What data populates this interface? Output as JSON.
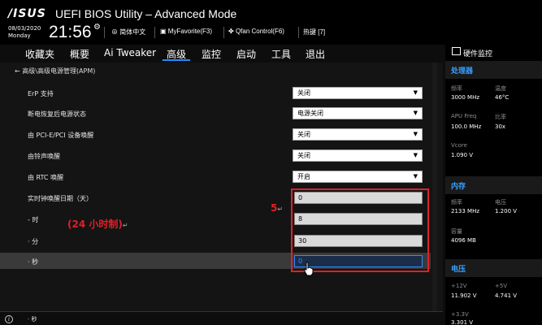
{
  "header": {
    "logo": "/ISUS",
    "title": "UEFI BIOS Utility – Advanced Mode",
    "date": "08/03/2020",
    "weekday": "Monday",
    "time": "21:56",
    "buttons": [
      {
        "icon": "globe-icon",
        "label": "简体中文"
      },
      {
        "icon": "favorite-icon",
        "label": "MyFavorite(F3)"
      },
      {
        "icon": "fan-icon",
        "label": "Qfan Control(F6)"
      },
      {
        "icon": "hotkey-icon",
        "label": "热键 [7]"
      }
    ]
  },
  "menu": {
    "items": [
      "收藏夹",
      "概要",
      "Ai Tweaker",
      "高级",
      "监控",
      "启动",
      "工具",
      "退出"
    ],
    "active": "高级"
  },
  "breadcrumb": "← 高级\\高级电源管理(APM)",
  "settings": [
    {
      "label": "ErP 支持",
      "value": "关闭"
    },
    {
      "label": "断电恢复后电源状态",
      "value": "电源关闭"
    },
    {
      "label": "由 PCI-E/PCI 设备唤醒",
      "value": "关闭"
    },
    {
      "label": "由铃声唤醒",
      "value": "关闭"
    },
    {
      "label": "由 RTC 唤醒",
      "value": "开启"
    },
    {
      "label": "实时钟唤醒日期（天）",
      "value": "0"
    },
    {
      "label": "- 时",
      "value": "8"
    },
    {
      "label": "· 分",
      "value": "30"
    },
    {
      "label": "· 秒",
      "value": "0"
    }
  ],
  "annotations": {
    "five": "5",
    "hours": "(24 小时制)",
    "return_mark": "↵"
  },
  "help_text": "· 秒",
  "monitor": {
    "title": "硬件监控",
    "cpu": {
      "heading": "处理器",
      "freq_label": "频率",
      "freq_value": "3000 MHz",
      "temp_label": "温度",
      "temp_value": "46°C",
      "apu_label": "APU Freq",
      "apu_value": "100.0 MHz",
      "ratio_label": "比率",
      "ratio_value": "30x",
      "vcore_label": "Vcore",
      "vcore_value": "1.090 V"
    },
    "memory": {
      "heading": "内存",
      "freq_label": "频率",
      "freq_value": "2133 MHz",
      "volt_label": "电压",
      "volt_value": "1.200 V",
      "cap_label": "容量",
      "cap_value": "4096 MB"
    },
    "voltage": {
      "heading": "电压",
      "v12_label": "+12V",
      "v12_value": "11.902 V",
      "v5_label": "+5V",
      "v5_value": "4.741 V",
      "v33_label": "+3.3V",
      "v33_value": "3.301 V"
    }
  }
}
